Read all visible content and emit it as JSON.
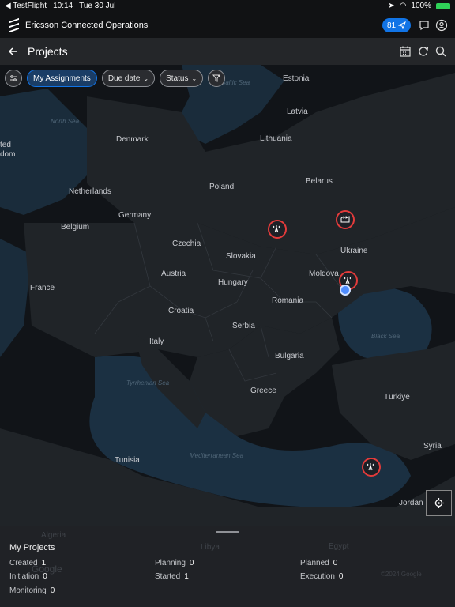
{
  "status_bar": {
    "back_app": "◀ TestFlight",
    "time": "10:14",
    "date": "Tue 30 Jul",
    "battery": "100%"
  },
  "app_bar": {
    "title": "Ericsson Connected Operations",
    "notifications_count": "81"
  },
  "page": {
    "title": "Projects"
  },
  "filters": {
    "my_assignments": "My Assignments",
    "due_date": "Due date",
    "status": "Status"
  },
  "map": {
    "country_labels": {
      "estonia": "Estonia",
      "latvia": "Latvia",
      "lithuania": "Lithuania",
      "denmark": "Denmark",
      "belarus": "Belarus",
      "poland": "Poland",
      "netherlands": "Netherlands",
      "germany": "Germany",
      "belgium": "Belgium",
      "czechia": "Czechia",
      "slovakia": "Slovakia",
      "ukraine": "Ukraine",
      "austria": "Austria",
      "moldova": "Moldova",
      "hungary": "Hungary",
      "france": "France",
      "romania": "Romania",
      "croatia": "Croatia",
      "serbia": "Serbia",
      "italy": "Italy",
      "bulgaria": "Bulgaria",
      "greece": "Greece",
      "turkiye": "Türkiye",
      "tunisia": "Tunisia",
      "syria": "Syria",
      "jordan": "Jordan",
      "uk_partial_1": "ted",
      "uk_partial_2": "dom",
      "algeria": "Algeria",
      "libya": "Libya",
      "egypt": "Egypt"
    },
    "sea_labels": {
      "baltic": "Baltic Sea",
      "north": "North Sea",
      "black": "Black Sea",
      "tyrrhenian": "Tyrrhenian Sea",
      "mediterranean": "Mediterranean Sea"
    },
    "attribution": "©2024 Google",
    "google_logo": "Google"
  },
  "my_projects": {
    "title": "My Projects",
    "created_label": "Created",
    "created_value": "1",
    "initiation_label": "Initiation",
    "initiation_value": "0",
    "monitoring_label": "Monitoring",
    "monitoring_value": "0",
    "planning_label": "Planning",
    "planning_value": "0",
    "started_label": "Started",
    "started_value": "1",
    "planned_label": "Planned",
    "planned_value": "0",
    "execution_label": "Execution",
    "execution_value": "0"
  },
  "colors": {
    "accent": "#1174e6",
    "marker": "#e23b3b"
  }
}
